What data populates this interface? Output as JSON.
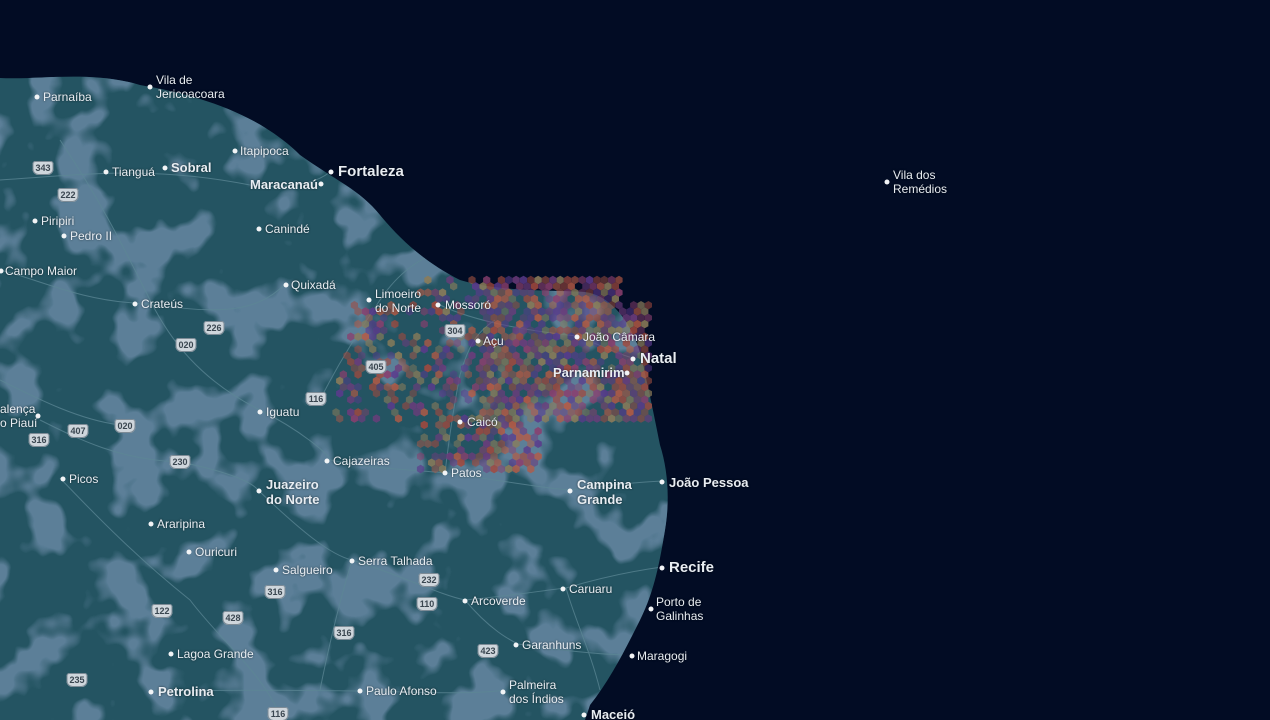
{
  "colors": {
    "ocean": "#020c24",
    "land": "#245462",
    "land_dark": "#1b3650",
    "hex_palette": [
      "#a2493e",
      "#8a3f6e",
      "#5b3a8c",
      "#8b7c5a",
      "#b55a45",
      "#6d3c7c"
    ]
  },
  "places": [
    {
      "name": "Parnaíba",
      "size": "sm"
    },
    {
      "name": "Vila de\nJericoacoara",
      "size": "sm"
    },
    {
      "name": "Itapipoca",
      "size": "sm"
    },
    {
      "name": "Tianguá",
      "size": "sm"
    },
    {
      "name": "Sobral",
      "size": "med"
    },
    {
      "name": "Fortaleza",
      "size": "big"
    },
    {
      "name": "Maracanaú",
      "size": "med"
    },
    {
      "name": "Vila dos\nRemédios",
      "size": "sm"
    },
    {
      "name": "Piripiri",
      "size": "sm"
    },
    {
      "name": "Pedro II",
      "size": "sm"
    },
    {
      "name": "Canindé",
      "size": "sm"
    },
    {
      "name": "Campo Maior",
      "size": "sm"
    },
    {
      "name": "Quixadá",
      "size": "sm"
    },
    {
      "name": "Limoeiro\ndo Norte",
      "size": "sm"
    },
    {
      "name": "Mossoró",
      "size": "sm"
    },
    {
      "name": "Crateús",
      "size": "sm"
    },
    {
      "name": "João Câmara",
      "size": "sm"
    },
    {
      "name": "Açu",
      "size": "sm"
    },
    {
      "name": "Natal",
      "size": "big"
    },
    {
      "name": "Parnamirim",
      "size": "med"
    },
    {
      "name": "alença\no Piauí",
      "size": "sm"
    },
    {
      "name": "Iguatu",
      "size": "sm"
    },
    {
      "name": "Caicó",
      "size": "sm"
    },
    {
      "name": "Cajazeiras",
      "size": "sm"
    },
    {
      "name": "Patos",
      "size": "sm"
    },
    {
      "name": "Picos",
      "size": "sm"
    },
    {
      "name": "Juazeiro\ndo Norte",
      "size": "med"
    },
    {
      "name": "Campina\nGrande",
      "size": "med"
    },
    {
      "name": "João Pessoa",
      "size": "med"
    },
    {
      "name": "Araripina",
      "size": "sm"
    },
    {
      "name": "Ouricuri",
      "size": "sm"
    },
    {
      "name": "Serra Talhada",
      "size": "sm"
    },
    {
      "name": "Salgueiro",
      "size": "sm"
    },
    {
      "name": "Recife",
      "size": "big"
    },
    {
      "name": "Caruaru",
      "size": "sm"
    },
    {
      "name": "Arcoverde",
      "size": "sm"
    },
    {
      "name": "Porto de\nGalinhas",
      "size": "sm"
    },
    {
      "name": "Garanhuns",
      "size": "sm"
    },
    {
      "name": "Lagoa Grande",
      "size": "sm"
    },
    {
      "name": "Maragogi",
      "size": "sm"
    },
    {
      "name": "Petrolina",
      "size": "med"
    },
    {
      "name": "Paulo Afonso",
      "size": "sm"
    },
    {
      "name": "Palmeira\ndos Índios",
      "size": "sm"
    },
    {
      "name": "Maceió",
      "size": "med"
    }
  ],
  "shields": [
    "343",
    "222",
    "226",
    "020",
    "304",
    "405",
    "116",
    "407",
    "020",
    "316",
    "230",
    "232",
    "110",
    "316",
    "122",
    "428",
    "316",
    "423",
    "235",
    "116"
  ]
}
